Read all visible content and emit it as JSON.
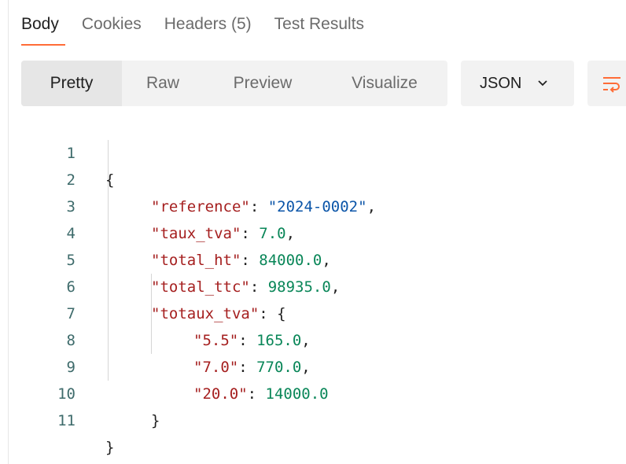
{
  "tabs": [
    {
      "label": "Body",
      "active": true
    },
    {
      "label": "Cookies",
      "active": false
    },
    {
      "label": "Headers",
      "count": "(5)",
      "active": false
    },
    {
      "label": "Test Results",
      "active": false
    }
  ],
  "view_modes": [
    {
      "label": "Pretty",
      "active": true
    },
    {
      "label": "Raw",
      "active": false
    },
    {
      "label": "Preview",
      "active": false
    },
    {
      "label": "Visualize",
      "active": false
    }
  ],
  "format_select": {
    "value": "JSON",
    "icon": "chevron-down-icon"
  },
  "wrap_button": {
    "icon": "wrap-lines-icon"
  },
  "colors": {
    "accent": "#ff6c37",
    "json_key": "#a51f1f",
    "json_string": "#0b55a8",
    "json_number": "#098658",
    "line_number": "#3e6b6b"
  },
  "code_lines": [
    {
      "n": "1",
      "open": "{"
    },
    {
      "n": "2",
      "key": "\"reference\"",
      "sep": ": ",
      "str": "\"2024-0002\"",
      "end": ","
    },
    {
      "n": "3",
      "key": "\"taux_tva\"",
      "sep": ": ",
      "num": "7.0",
      "end": ","
    },
    {
      "n": "4",
      "key": "\"total_ht\"",
      "sep": ": ",
      "num": "84000.0",
      "end": ","
    },
    {
      "n": "5",
      "key": "\"total_ttc\"",
      "sep": ": ",
      "num": "98935.0",
      "end": ","
    },
    {
      "n": "6",
      "key": "\"totaux_tva\"",
      "sep": ": ",
      "open": "{"
    },
    {
      "n": "7",
      "key": "\"5.5\"",
      "sep": ": ",
      "num": "165.0",
      "end": ","
    },
    {
      "n": "8",
      "key": "\"7.0\"",
      "sep": ": ",
      "num": "770.0",
      "end": ","
    },
    {
      "n": "9",
      "key": "\"20.0\"",
      "sep": ": ",
      "num": "14000.0"
    },
    {
      "n": "10",
      "close": "}"
    },
    {
      "n": "11",
      "close": "}"
    }
  ]
}
